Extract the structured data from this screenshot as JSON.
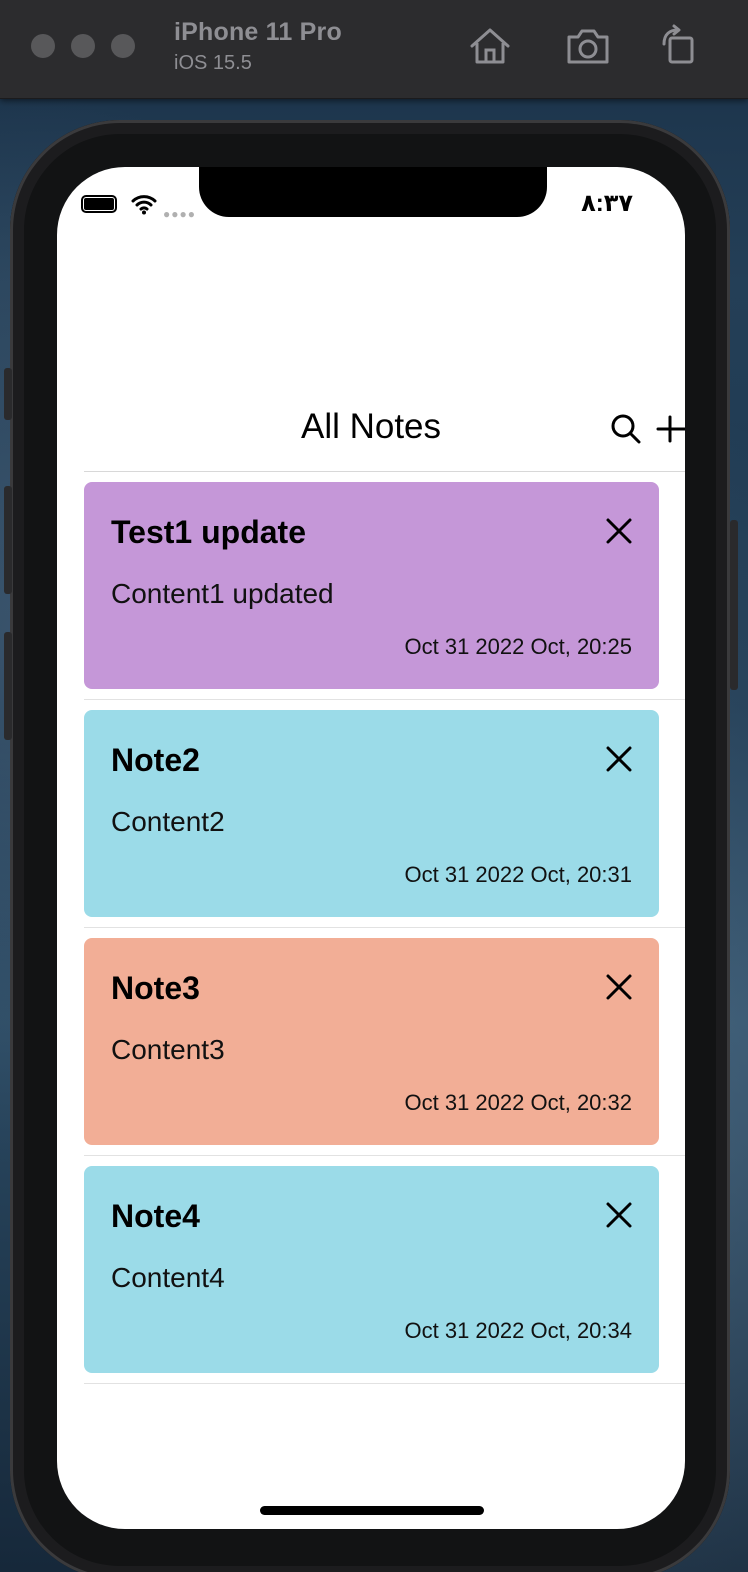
{
  "simulator": {
    "device_name": "iPhone 11 Pro",
    "os_version": "iOS 15.5",
    "toolbar": [
      {
        "icon": "home-icon"
      },
      {
        "icon": "screenshot-camera-icon"
      },
      {
        "icon": "rotate-icon"
      }
    ]
  },
  "status_bar": {
    "time": "٨:٣٧"
  },
  "nav": {
    "title": "All Notes",
    "search_icon": "search-icon",
    "add_icon": "plus-icon"
  },
  "notes": [
    {
      "title": "Test1 update",
      "content": "Content1 updated",
      "date": "Oct 31 2022 Oct, 20:25",
      "color": "#c597d8"
    },
    {
      "title": "Note2",
      "content": "Content2",
      "date": "Oct 31 2022 Oct, 20:31",
      "color": "#9bdbe8"
    },
    {
      "title": "Note3",
      "content": "Content3",
      "date": "Oct 31 2022 Oct, 20:32",
      "color": "#f2ae96"
    },
    {
      "title": "Note4",
      "content": "Content4",
      "date": "Oct 31 2022 Oct, 20:34",
      "color": "#9bdbe8"
    }
  ],
  "colors": {
    "sim_bar": "#2c2c2e",
    "screen_bg": "#ffffff"
  }
}
